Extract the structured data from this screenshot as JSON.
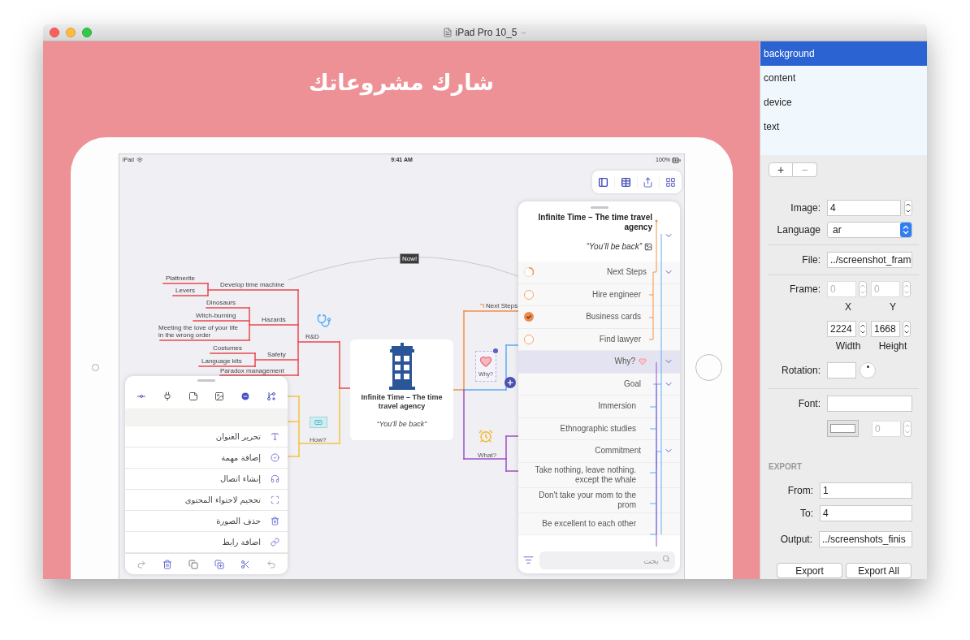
{
  "window": {
    "title": "iPad Pro 10_5"
  },
  "canvas": {
    "heading": "شارك مشروعاتك"
  },
  "status_bar": {
    "device": "iPad",
    "time": "9:41 AM",
    "battery": "100%"
  },
  "mind_map": {
    "marker": "Now!",
    "central": {
      "title": "Infinite Time – The time travel agency",
      "note": "“You’ll be back”"
    },
    "branches": [
      {
        "label": "R&D",
        "children": [
          {
            "label": "Develop time machine",
            "children": [
              {
                "label": "Plattnerite"
              },
              {
                "label": "Levers"
              }
            ]
          },
          {
            "label": "Hazards",
            "children": [
              {
                "label": "Dinosaurs"
              },
              {
                "label": "Witch-burning"
              },
              {
                "label": "Meeting the love of your life in the wrong order"
              }
            ]
          },
          {
            "label": "Safety",
            "children": [
              {
                "label": "Costumes"
              },
              {
                "label": "Language kits"
              }
            ]
          },
          {
            "label": "Paradox management"
          }
        ]
      },
      {
        "label": "How?"
      },
      {
        "label": "Next Steps"
      },
      {
        "label": "Why?"
      },
      {
        "label": "What?"
      }
    ]
  },
  "action_sheet": {
    "items": [
      {
        "label": "تحرير العنوان"
      },
      {
        "label": "إضافة مهمة"
      },
      {
        "label": "إنشاء اتصال"
      },
      {
        "label": "تحجيم لاحتواء المحتوى"
      },
      {
        "label": "حذف الصورة"
      },
      {
        "label": "اضافة رابط"
      }
    ]
  },
  "outline": {
    "title": "Infinite Time – The time travel agency",
    "note": "“You’ll be back”",
    "expanded": true,
    "items": [
      {
        "label": "Next Steps",
        "kind": "progress",
        "expanded": true,
        "selected": false,
        "children": [
          {
            "label": "Hire engineer",
            "kind": "task",
            "checked": false,
            "selected": false
          },
          {
            "label": "Business cards",
            "kind": "task",
            "checked": true,
            "selected": false
          },
          {
            "label": "Find lawyer",
            "kind": "task",
            "checked": false,
            "selected": false
          }
        ]
      },
      {
        "label": "Why?",
        "expanded": true,
        "selected": true,
        "children": [
          {
            "label": "Goal",
            "expanded": true,
            "selected": false,
            "children": [
              {
                "label": "Immersion",
                "selected": false
              },
              {
                "label": "Ethnographic studies",
                "selected": false
              }
            ]
          },
          {
            "label": "Commitment",
            "expanded": true,
            "selected": false,
            "children": [
              {
                "label": "Take nothing, leave nothing. except the whale",
                "selected": false
              },
              {
                "label": "Don't take your mom to the prom",
                "selected": false
              },
              {
                "label": "Be excellent to each other",
                "selected": false
              }
            ]
          }
        ]
      }
    ],
    "search": {
      "placeholder": "بحث"
    }
  },
  "layers": {
    "items": [
      {
        "label": "background",
        "selected": true
      },
      {
        "label": "content",
        "selected": false
      },
      {
        "label": "device",
        "selected": false
      },
      {
        "label": "text",
        "selected": false
      }
    ],
    "buttons": [
      "+",
      "−"
    ]
  },
  "inspector": {
    "image": {
      "label": "Image:",
      "value": "4"
    },
    "language": {
      "label": "Language",
      "value": "ar"
    },
    "file": {
      "label": "File:",
      "value": "../screenshot_fram"
    },
    "frame": {
      "label": "Frame:",
      "x": {
        "value": "0",
        "caption": "X",
        "disabled": true
      },
      "y": {
        "value": "0",
        "caption": "Y",
        "disabled": true
      },
      "width": {
        "value": "2224",
        "caption": "Width",
        "disabled": false
      },
      "height": {
        "value": "1668",
        "caption": "Height",
        "disabled": false
      }
    },
    "rotation": {
      "label": "Rotation:"
    },
    "font": {
      "label": "Font:",
      "size": {
        "value": "0",
        "disabled": true
      }
    }
  },
  "export": {
    "heading": "EXPORT",
    "from": {
      "label": "From:",
      "value": "1"
    },
    "to": {
      "label": "To:",
      "value": "4"
    },
    "output": {
      "label": "Output:",
      "value": "../screenshots_finis"
    },
    "buttons": [
      "Export",
      "Export All"
    ]
  }
}
